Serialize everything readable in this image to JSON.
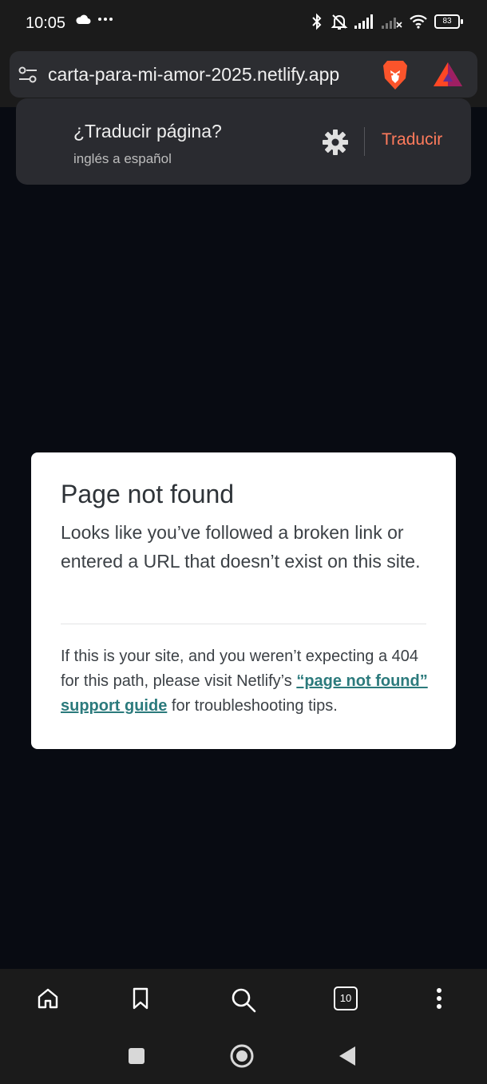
{
  "status_bar": {
    "time": "10:05",
    "left_icons": [
      "cloud-icon",
      "more-dots-icon"
    ],
    "right_icons": [
      "bluetooth-icon",
      "bell-off-icon",
      "signal-icon",
      "signal-no-data-icon",
      "wifi-icon"
    ],
    "battery": "83"
  },
  "browser": {
    "url": "carta-para-mi-amor-2025.netlify.app"
  },
  "translate_bar": {
    "title": "¿Traducir página?",
    "subtitle": "inglés a español",
    "button": "Traducir",
    "accent": "#ff7b5c"
  },
  "error_page": {
    "title": "Page not found",
    "body": "Looks like you’ve followed a broken link or entered a URL that doesn’t exist on this site.",
    "help_before": "If this is your site, and you weren’t expecting a 404 for this path, please visit Netlify’s ",
    "help_link": "“page not found” support guide",
    "help_after": " for troubleshooting tips.",
    "link_color": "#2b7a7c"
  },
  "bottom_toolbar": {
    "tab_count": "10",
    "icons": [
      "home-icon",
      "bookmark-icon",
      "search-icon",
      "tabs-icon",
      "menu-icon"
    ]
  },
  "nav_bar": {
    "icons": [
      "recents-icon",
      "home-circle-icon",
      "back-icon"
    ]
  }
}
